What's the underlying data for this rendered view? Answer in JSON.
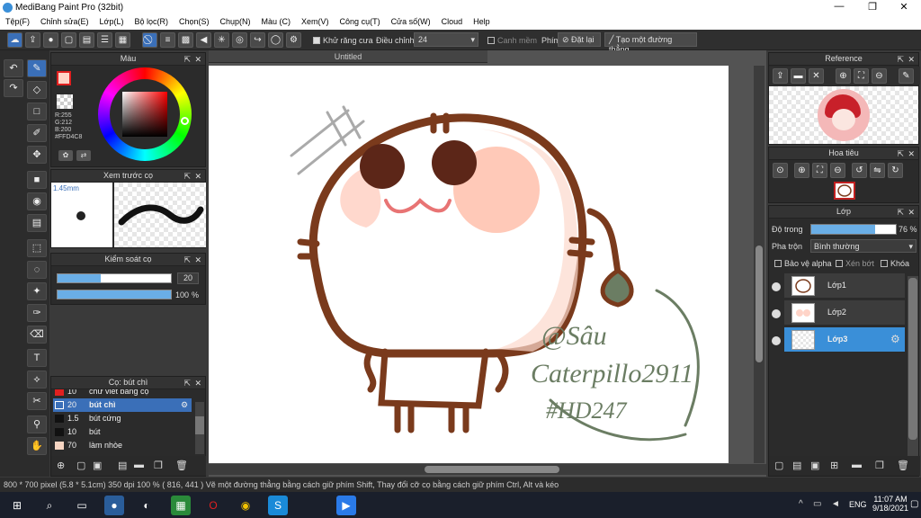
{
  "title": "MediBang Paint Pro (32bit)",
  "menu": [
    "Tệp(F)",
    "Chỉnh sửa(E)",
    "Lớp(L)",
    "Bộ lọc(R)",
    "Chọn(S)",
    "Chụp(N)",
    "Màu (C)",
    "Xem(V)",
    "Công cụ(T)",
    "Cửa số(W)",
    "Cloud",
    "Help"
  ],
  "toolbar": {
    "antialias_label": "Khử răng cưa",
    "adjust_label": "Điều chỉnh",
    "adjust_value": "24",
    "smooth_label": "Canh mềm",
    "key_label": "Phím",
    "reset_label": "Đặt lại",
    "create_line_label": "Tạo một đường thẳng"
  },
  "color_panel": {
    "title": "Màu",
    "rgb": [
      "R:255",
      "G:212",
      "B:200"
    ],
    "hex": "#FFD4C8",
    "primary_color": "#ffd4c8"
  },
  "brush_preview": {
    "title": "Xem trước cọ",
    "size": "1.45mm"
  },
  "brush_control": {
    "title": "Kiểm soát cọ",
    "size_value": "20",
    "opacity_value": "100",
    "opacity_unit": "%",
    "size_level": 0.38,
    "opacity_level": 1.0
  },
  "brush_list": {
    "title": "Cọ: bút chì",
    "items": [
      {
        "size": "10",
        "name": "chữ viết bằng cọ",
        "color": "#e02020",
        "active": false
      },
      {
        "size": "20",
        "name": "bút chì",
        "color": "#3a6fb8",
        "active": true
      },
      {
        "size": "1.5",
        "name": "bút cứng",
        "color": "#111111",
        "active": false
      },
      {
        "size": "10",
        "name": "bút",
        "color": "#111111",
        "active": false
      },
      {
        "size": "70",
        "name": "làm nhòe",
        "color": "#f6d5c2",
        "active": false
      }
    ]
  },
  "canvas": {
    "tab": "Untitled"
  },
  "reference": {
    "title": "Reference"
  },
  "navigator": {
    "title": "Hoa tiêu"
  },
  "layers": {
    "title": "Lớp",
    "opacity_label": "Độ trong",
    "opacity_value": "76 %",
    "opacity_level": 0.76,
    "blend_label": "Pha trộn",
    "blend_value": "Bình thường",
    "protect_alpha": "Bảo vệ alpha",
    "clipping": "Xén bớt",
    "lock": "Khóa",
    "items": [
      {
        "name": "Lớp1",
        "active": false
      },
      {
        "name": "Lớp2",
        "active": false
      },
      {
        "name": "Lớp3",
        "active": true
      }
    ]
  },
  "artwork_text": [
    "@Sâu",
    "Caterpillo2911",
    "#HD247"
  ],
  "status": {
    "size": "800 * 700 pixel",
    "cm": "(5.8 * 5.1cm)",
    "dpi": "350 dpi",
    "zoom": "100 %",
    "coords": "( 816, 441 )",
    "hint": "Vẽ một đường thẳng bằng cách giữ phím Shift, Thay đổi cỡ cọ bằng cách giữ phím Ctrl, Alt và kéo"
  },
  "taskbar": {
    "lang": "ENG",
    "time": "11:07 AM",
    "date": "9/18/2021"
  }
}
